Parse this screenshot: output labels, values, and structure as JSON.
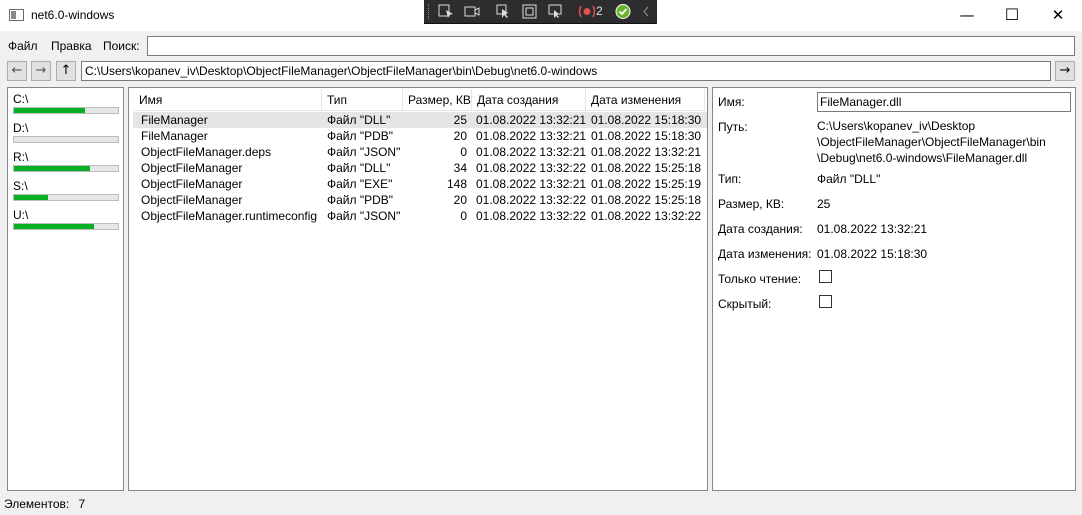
{
  "window": {
    "title": "net6.0-windows",
    "minimize_glyph": "—",
    "maximize_glyph": "☐",
    "close_glyph": "✕"
  },
  "debug_toolbar": {
    "icons": [
      "select-element-icon",
      "record-icon",
      "pointer-icon",
      "display-layout-icon",
      "track-focus-icon",
      "binding-failures-icon",
      "hot-reload-icon",
      "collapse-icon"
    ],
    "binding_failures_count": "2"
  },
  "menu": {
    "file": "Файл",
    "edit": "Правка",
    "search_label": "Поиск:",
    "search_value": ""
  },
  "nav": {
    "back": "←",
    "forward": "→",
    "up": "↑",
    "go": "→",
    "path": "C:\\Users\\kopanev_iv\\Desktop\\ObjectFileManager\\ObjectFileManager\\bin\\Debug\\net6.0-windows"
  },
  "drives": [
    {
      "label": "C:\\",
      "usage": 0.68
    },
    {
      "label": "D:\\",
      "usage": 0.0
    },
    {
      "label": "R:\\",
      "usage": 0.73
    },
    {
      "label": "S:\\",
      "usage": 0.33
    },
    {
      "label": "U:\\",
      "usage": 0.77
    }
  ],
  "files": {
    "columns": [
      "Имя",
      "Тип",
      "Размер, КВ",
      "Дата создания",
      "Дата изменения"
    ],
    "rows": [
      {
        "name": "FileManager",
        "type": "Файл \"DLL\"",
        "size": "25",
        "created": "01.08.2022 13:32:21",
        "modified": "01.08.2022 15:18:30"
      },
      {
        "name": "FileManager",
        "type": "Файл \"PDB\"",
        "size": "20",
        "created": "01.08.2022 13:32:21",
        "modified": "01.08.2022 15:18:30"
      },
      {
        "name": "ObjectFileManager.deps",
        "type": "Файл \"JSON\"",
        "size": "0",
        "created": "01.08.2022 13:32:21",
        "modified": "01.08.2022 13:32:21"
      },
      {
        "name": "ObjectFileManager",
        "type": "Файл \"DLL\"",
        "size": "34",
        "created": "01.08.2022 13:32:22",
        "modified": "01.08.2022 15:25:18"
      },
      {
        "name": "ObjectFileManager",
        "type": "Файл \"EXE\"",
        "size": "148",
        "created": "01.08.2022 13:32:21",
        "modified": "01.08.2022 15:25:19"
      },
      {
        "name": "ObjectFileManager",
        "type": "Файл \"PDB\"",
        "size": "20",
        "created": "01.08.2022 13:32:22",
        "modified": "01.08.2022 15:25:18"
      },
      {
        "name": "ObjectFileManager.runtimeconfig",
        "type": "Файл \"JSON\"",
        "size": "0",
        "created": "01.08.2022 13:32:22",
        "modified": "01.08.2022 13:32:22"
      }
    ]
  },
  "details": {
    "name_label": "Имя:",
    "name_value": "FileManager.dll",
    "path_label": "Путь:",
    "path_lines": [
      "C:\\Users\\kopanev_iv\\Desktop",
      "\\ObjectFileManager\\ObjectFileManager\\bin",
      "\\Debug\\net6.0-windows\\FileManager.dll"
    ],
    "type_label": "Тип:",
    "type_value": "Файл \"DLL\"",
    "size_label": "Размер, КВ:",
    "size_value": "25",
    "created_label": "Дата создания:",
    "created_value": "01.08.2022 13:32:21",
    "modified_label": "Дата изменения:",
    "modified_value": "01.08.2022 15:18:30",
    "readonly_label": "Только чтение:",
    "readonly_checked": false,
    "hidden_label": "Скрытый:",
    "hidden_checked": false
  },
  "status": {
    "label": "Элементов:",
    "count": "7"
  },
  "colors": {
    "drive_fill": "#06b025",
    "selection": "#e5e5e5",
    "debug_toolbar_bg": "#2d2d30",
    "hot_reload_ok": "#6ab42d",
    "binding_failures": "#e05050"
  }
}
